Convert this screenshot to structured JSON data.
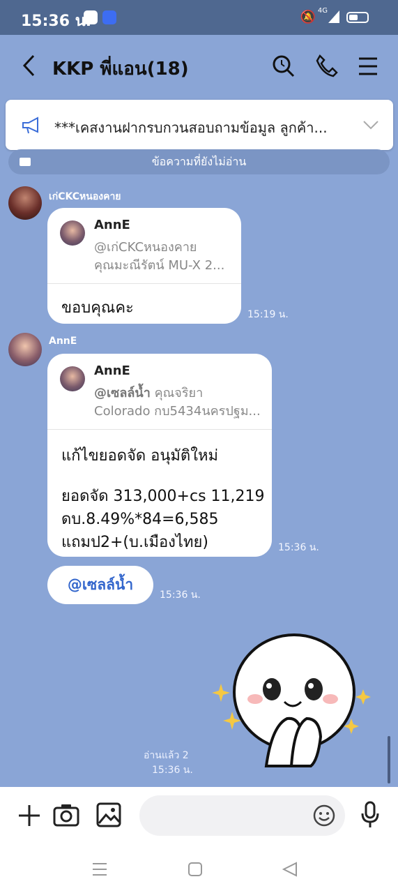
{
  "status": {
    "time": "15:36 น.",
    "network": "4G"
  },
  "header": {
    "title": "KKP พี่แอน(18)"
  },
  "announcement": {
    "text": "***เคสงานฝากรบกวนสอบถามข้อมูล ลูกค้า..."
  },
  "unread_label": "ข้อความที่ยังไม่อ่าน",
  "messages": [
    {
      "sender": "เก่CKCหนองคาย",
      "reply": {
        "name": "AnnE",
        "line1": "@เก่CKCหนองคาย",
        "line2": "คุณมะณีรัตน์ MU-X 2..."
      },
      "text": "ขอบคุณคะ",
      "time": "15:19 น."
    },
    {
      "sender": "AnnE",
      "reply": {
        "name": "AnnE",
        "line1_bold": "@เซลล์น้ำ",
        "line1_rest": " คุณจริยา",
        "line2": "Colorado กบ5434นครปฐม..."
      },
      "text_lines": [
        "แก้ไขยอดจัด อนุมัติใหม่",
        "ยอดจัด 313,000+cs 11,219",
        "ดบ.8.49%*84=6,585",
        "แถมป2+(บ.เมืองไทย)"
      ],
      "time": "15:36 น."
    },
    {
      "mention": "@เซลล์น้ำ",
      "time": "15:36 น."
    }
  ],
  "read_receipt": {
    "label": "อ่านแล้ว 2",
    "time": "15:36 น."
  },
  "colors": {
    "chat_bg": "#8aa5d6",
    "mention": "#3366cc"
  }
}
